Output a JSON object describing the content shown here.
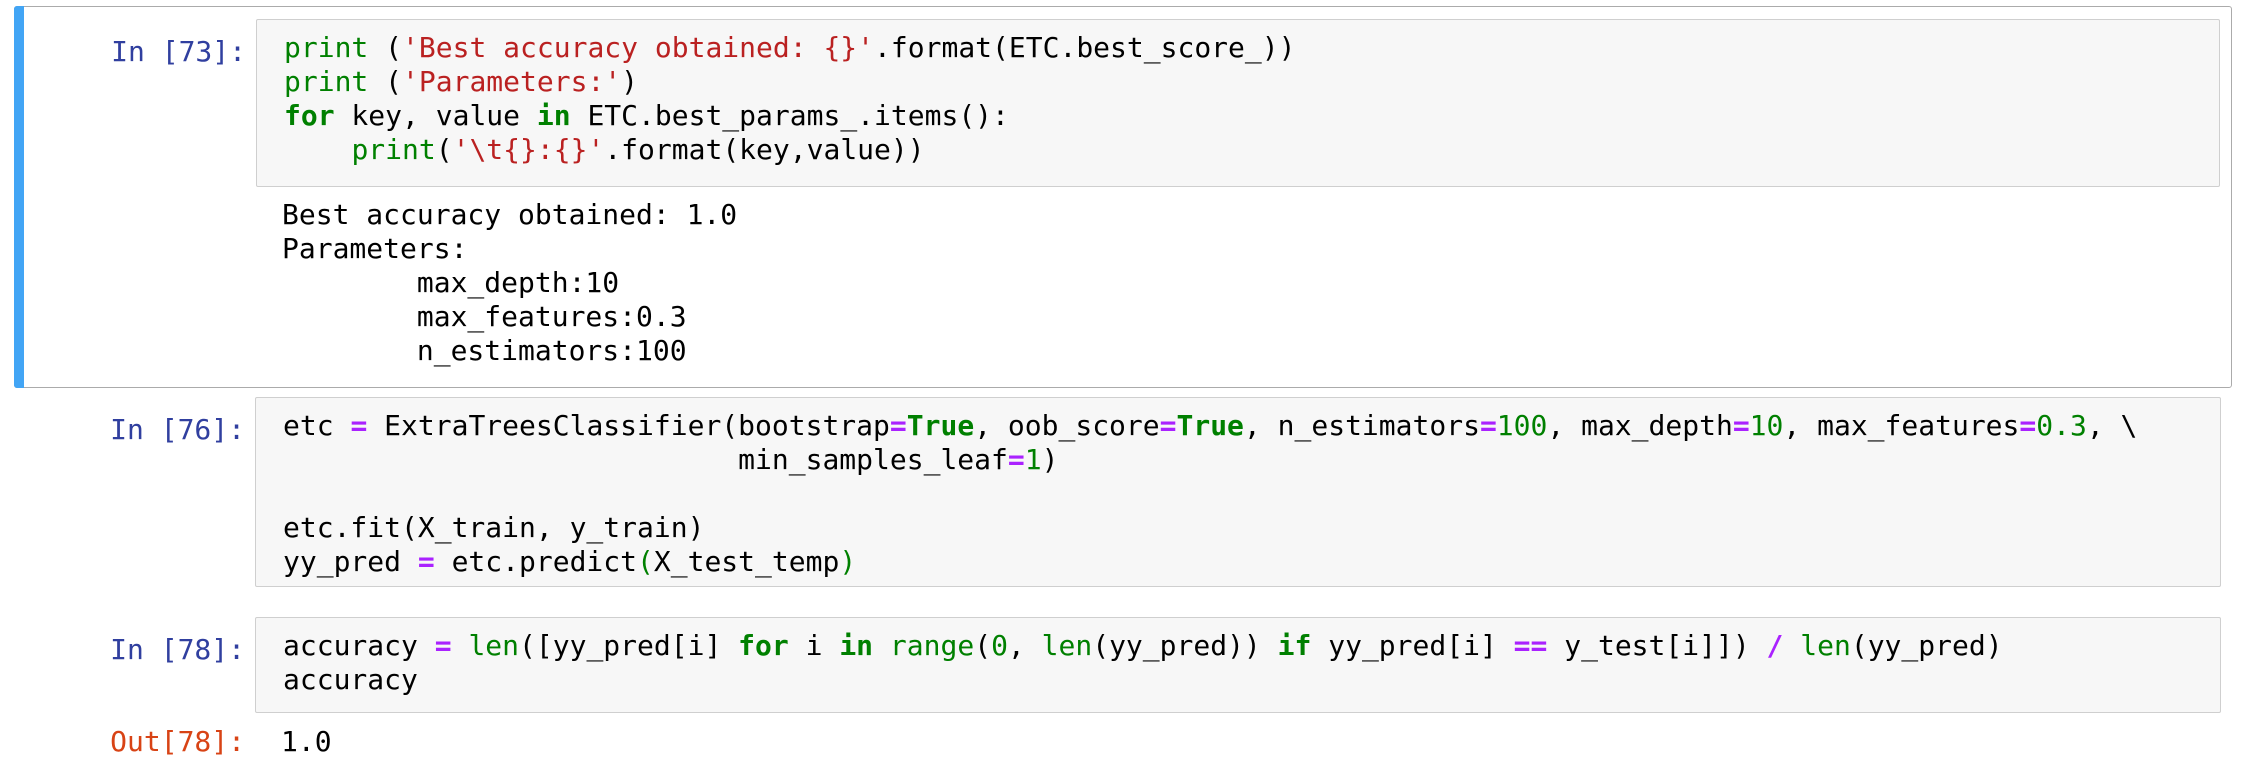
{
  "cells": [
    {
      "prompt": "In [73]:",
      "code_lines": [
        [
          {
            "t": "print",
            "c": "bi"
          },
          {
            "t": " (",
            "c": ""
          },
          {
            "t": "'Best accuracy obtained: {}'",
            "c": "str"
          },
          {
            "t": ".format(ETC.best_score_))",
            "c": ""
          }
        ],
        [
          {
            "t": "print",
            "c": "bi"
          },
          {
            "t": " (",
            "c": ""
          },
          {
            "t": "'Parameters:'",
            "c": "str"
          },
          {
            "t": ")",
            "c": ""
          }
        ],
        [
          {
            "t": "for",
            "c": "kw"
          },
          {
            "t": " key, value ",
            "c": ""
          },
          {
            "t": "in",
            "c": "kw"
          },
          {
            "t": " ETC.best_params_.items():",
            "c": ""
          }
        ],
        [
          {
            "t": "    ",
            "c": ""
          },
          {
            "t": "print",
            "c": "bi"
          },
          {
            "t": "(",
            "c": ""
          },
          {
            "t": "'\\t{}:{}'",
            "c": "str"
          },
          {
            "t": ".format(key,value))",
            "c": ""
          }
        ]
      ],
      "output_lines": [
        "Best accuracy obtained: 1.0",
        "Parameters:",
        "\tmax_depth:10",
        "\tmax_features:0.3",
        "\tn_estimators:100"
      ]
    },
    {
      "prompt": "In [76]:",
      "code_lines": [
        [
          {
            "t": "etc ",
            "c": ""
          },
          {
            "t": "=",
            "c": "op"
          },
          {
            "t": " ExtraTreesClassifier(bootstrap",
            "c": ""
          },
          {
            "t": "=",
            "c": "op"
          },
          {
            "t": "True",
            "c": "kw"
          },
          {
            "t": ", oob_score",
            "c": ""
          },
          {
            "t": "=",
            "c": "op"
          },
          {
            "t": "True",
            "c": "kw"
          },
          {
            "t": ", n_estimators",
            "c": ""
          },
          {
            "t": "=",
            "c": "op"
          },
          {
            "t": "100",
            "c": "num"
          },
          {
            "t": ", max_depth",
            "c": ""
          },
          {
            "t": "=",
            "c": "op"
          },
          {
            "t": "10",
            "c": "num"
          },
          {
            "t": ", max_features",
            "c": ""
          },
          {
            "t": "=",
            "c": "op"
          },
          {
            "t": "0.3",
            "c": "num"
          },
          {
            "t": ", \\",
            "c": ""
          }
        ],
        [
          {
            "t": "                           min_samples_leaf",
            "c": ""
          },
          {
            "t": "=",
            "c": "op"
          },
          {
            "t": "1",
            "c": "num"
          },
          {
            "t": ")",
            "c": ""
          }
        ],
        [
          {
            "t": "",
            "c": ""
          }
        ],
        [
          {
            "t": "etc.fit(X_train, y_train)",
            "c": ""
          }
        ],
        [
          {
            "t": "yy_pred ",
            "c": ""
          },
          {
            "t": "=",
            "c": "op"
          },
          {
            "t": " etc.predict",
            "c": ""
          },
          {
            "t": "(",
            "c": "paren"
          },
          {
            "t": "X_test_temp",
            "c": ""
          },
          {
            "t": ")",
            "c": "paren"
          }
        ]
      ]
    },
    {
      "prompt": "In [78]:",
      "code_lines": [
        [
          {
            "t": "accuracy ",
            "c": ""
          },
          {
            "t": "=",
            "c": "op"
          },
          {
            "t": " ",
            "c": ""
          },
          {
            "t": "len",
            "c": "bi"
          },
          {
            "t": "([yy_pred[i] ",
            "c": ""
          },
          {
            "t": "for",
            "c": "kw"
          },
          {
            "t": " i ",
            "c": ""
          },
          {
            "t": "in",
            "c": "kw"
          },
          {
            "t": " ",
            "c": ""
          },
          {
            "t": "range",
            "c": "bi"
          },
          {
            "t": "(",
            "c": ""
          },
          {
            "t": "0",
            "c": "num"
          },
          {
            "t": ", ",
            "c": ""
          },
          {
            "t": "len",
            "c": "bi"
          },
          {
            "t": "(yy_pred)) ",
            "c": ""
          },
          {
            "t": "if",
            "c": "kw"
          },
          {
            "t": " yy_pred[i] ",
            "c": ""
          },
          {
            "t": "==",
            "c": "op"
          },
          {
            "t": " y_test[i]]) ",
            "c": ""
          },
          {
            "t": "/",
            "c": "op"
          },
          {
            "t": " ",
            "c": ""
          },
          {
            "t": "len",
            "c": "bi"
          },
          {
            "t": "(yy_pred)",
            "c": ""
          }
        ],
        [
          {
            "t": "accuracy",
            "c": ""
          }
        ]
      ],
      "out_prompt": "Out[78]:",
      "result": "1.0"
    }
  ]
}
